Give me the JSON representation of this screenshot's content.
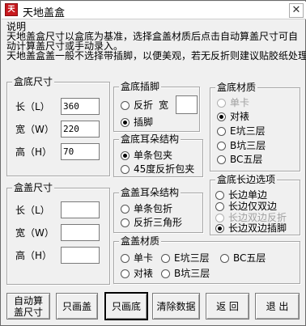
{
  "window": {
    "title": "天地盖盒",
    "close_glyph": "✕",
    "icon_glyph": "TDG"
  },
  "description": {
    "heading": "说明",
    "line1": "天地盖盒尺寸以盒底为基准，选择盒盖材质后点击自动算盖尺寸可自",
    "line2": "动计算盖尺寸或手动录入。",
    "line3": "天地盖盒盖一般不选择带插脚，以便美观，若无反折则建议贴胶纸处理。"
  },
  "base_size": {
    "title": "盒底尺寸",
    "length_label": "长（L）",
    "length_value": "360",
    "width_label": "宽（W）",
    "width_value": "220",
    "height_label": "高（H）",
    "height_value": "70"
  },
  "lid_size": {
    "title": "盒盖尺寸",
    "length_label": "长（L）",
    "length_value": "",
    "width_label": "宽（W）",
    "width_value": "",
    "height_label": "高（H）",
    "height_value": ""
  },
  "base_tab": {
    "title": "盒底插脚",
    "option1": "反折",
    "width_label": "宽",
    "width_value": "",
    "option2": "插脚"
  },
  "base_ear": {
    "title": "盒底耳朵结构",
    "option1": "单条包夹",
    "option2": "45度反折包夹"
  },
  "lid_ear": {
    "title": "盒盖耳朵结构",
    "option1": "单条包折",
    "option2": "反折三角形"
  },
  "base_material": {
    "title": "盒底材质",
    "options": [
      "单卡",
      "对裱",
      "E坑三层",
      "B坑三层",
      "BC五层"
    ]
  },
  "base_edge": {
    "title": "盒底长边选项",
    "options": [
      "长边单边",
      "长边仅双边",
      "长边双边反折",
      "长边双边插脚"
    ]
  },
  "lid_material": {
    "title": "盒盖材质",
    "options": [
      "单卡",
      "E坑三层",
      "BC五层",
      "对裱",
      "B坑三层"
    ]
  },
  "buttons": {
    "auto_calc": "自动算盖尺寸",
    "lid_only": "只画盖",
    "base_only": "只画底",
    "clear": "清除数据",
    "back": "返 回",
    "exit": "退 出"
  }
}
